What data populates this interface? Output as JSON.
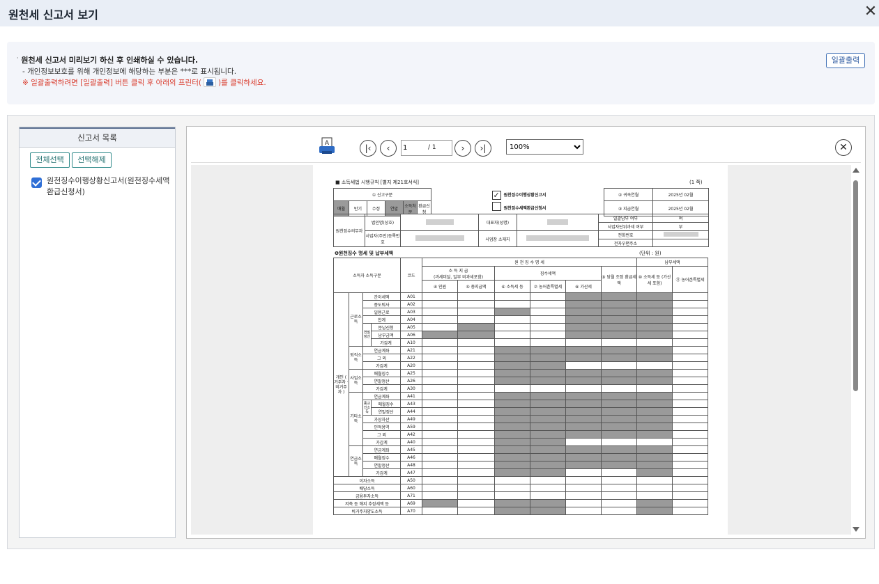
{
  "header": {
    "title": "원천세 신고서 보기",
    "close_icon": "close-icon"
  },
  "notice": {
    "line1": "원천세 신고서 미리보기 하신 후 인쇄하실 수 있습니다.",
    "line2": "- 개인정보보호를 위해 개인정보에 해당하는 부분은  ***로 표시됩니다.",
    "line3_pre": "※ 일괄출력하려면 [일괄출력] 버튼 클릭 후 아래의 프린터(",
    "line3_post": ")를 클릭하세요.",
    "bulk_print_button": "일괄출력"
  },
  "list_panel": {
    "title": "신고서 목록",
    "select_all": "전체선택",
    "deselect": "선택해제",
    "item_label": "원천징수이행상황신고서(원천징수세액환급신청서)",
    "item_checked": true
  },
  "viewer": {
    "page_current": "1",
    "page_total": "/ 1",
    "zoom": "100%",
    "zoom_options": [
      "100%"
    ]
  },
  "document": {
    "law_ref": "■ 소득세법 시행규칙 [별지 제21호서식]",
    "page_mark": "(1 쪽)",
    "report_type_label": "① 신고구분",
    "types": [
      "매월",
      "반기",
      "수정",
      "연말",
      "소득처분",
      "환급신청"
    ],
    "title1": "원천징수이행상황신고서",
    "title2": "원천징수세액환급신청서",
    "title1_checked": true,
    "period_label1": "② 귀속연월",
    "period_value1": "2025년 02월",
    "period_label2": "③ 지급연월",
    "period_value2": "2025년 02월",
    "payer_label": "원천징수의무자",
    "corp_name_label": "법인명(상호)",
    "rep_label": "대표자(성명)",
    "bizno_label": "사업자(주민)등록번호",
    "addr_label": "사업장 소재지",
    "bulk_pay_label": "일괄납부 여부",
    "bulk_pay_value": "여",
    "unit_tax_label": "사업자단위과세 여부",
    "unit_tax_value": "부",
    "phone_label": "전화번호",
    "email_label": "전자우편주소",
    "section1": "❶원천징수 명세 및 납부세액",
    "unit": "(단위 : 원)",
    "col_detail": "원 천 징 수 명 세",
    "col_pay": "납부세액",
    "col_category": "소득자 소득구분",
    "col_code": "코드",
    "col_income": "소 득 지 급",
    "col_income_sub": "(과세미달, 일부 비과세포함)",
    "col_tax": "징수세액",
    "col_4": "④ 인원",
    "col_5": "⑤ 총지급액",
    "col_6": "⑥ 소득세 등",
    "col_7": "⑦ 농어촌특별세",
    "col_8": "⑧ 가산세",
    "col_9": "⑨ 당월 조정 환급세액",
    "col_10": "⑩ 소득세 등 (가산세 포함)",
    "col_11": "⑪ 농어촌특별세",
    "vert_group": "개인 ( 거주자 · 비거주자 )",
    "rows": [
      {
        "grp": "근로소득",
        "sub": "",
        "name": "간이세액",
        "code": "A01"
      },
      {
        "grp": "",
        "sub": "",
        "name": "중도퇴사",
        "code": "A02"
      },
      {
        "grp": "",
        "sub": "",
        "name": "일용근로",
        "code": "A03"
      },
      {
        "grp": "",
        "sub": "",
        "name": "합계",
        "code": "A04"
      },
      {
        "grp": "",
        "sub": "연말정산",
        "name": "분납신청",
        "code": "A05"
      },
      {
        "grp": "",
        "sub": "",
        "name": "납부금액",
        "code": "A06"
      },
      {
        "grp": "",
        "sub": "",
        "name": "가감계",
        "code": "A10"
      },
      {
        "grp": "퇴직소득",
        "sub": "",
        "name": "연금계좌",
        "code": "A21"
      },
      {
        "grp": "",
        "sub": "",
        "name": "그 외",
        "code": "A22"
      },
      {
        "grp": "",
        "sub": "",
        "name": "가감계",
        "code": "A20"
      },
      {
        "grp": "사업소득",
        "sub": "",
        "name": "매월징수",
        "code": "A25"
      },
      {
        "grp": "",
        "sub": "",
        "name": "연말정산",
        "code": "A26"
      },
      {
        "grp": "",
        "sub": "",
        "name": "가감계",
        "code": "A30"
      },
      {
        "grp": "기타소득",
        "sub": "",
        "name": "연금계좌",
        "code": "A41"
      },
      {
        "grp": "",
        "sub": "종교인소득",
        "name": "매월징수",
        "code": "A43"
      },
      {
        "grp": "",
        "sub": "",
        "name": "연말정산",
        "code": "A44"
      },
      {
        "grp": "",
        "sub": "",
        "name": "가상자산",
        "code": "A49"
      },
      {
        "grp": "",
        "sub": "",
        "name": "인적용역",
        "code": "A59"
      },
      {
        "grp": "",
        "sub": "",
        "name": "그 외",
        "code": "A42"
      },
      {
        "grp": "",
        "sub": "",
        "name": "가감계",
        "code": "A40"
      },
      {
        "grp": "연금소득",
        "sub": "",
        "name": "연금계좌",
        "code": "A45"
      },
      {
        "grp": "",
        "sub": "",
        "name": "매월징수",
        "code": "A46"
      },
      {
        "grp": "",
        "sub": "",
        "name": "연말정산",
        "code": "A48"
      },
      {
        "grp": "",
        "sub": "",
        "name": "가감계",
        "code": "A47"
      },
      {
        "grp": "",
        "sub": "",
        "name": "이자소득",
        "code": "A50"
      },
      {
        "grp": "",
        "sub": "",
        "name": "배당소득",
        "code": "A60"
      },
      {
        "grp": "",
        "sub": "",
        "name": "금융투자소득",
        "code": "A71"
      },
      {
        "grp": "",
        "sub": "",
        "name": "저축 등 해지 추징세액 등",
        "code": "A69"
      },
      {
        "grp": "",
        "sub": "",
        "name": "비거주자양도소득",
        "code": "A70"
      }
    ]
  }
}
